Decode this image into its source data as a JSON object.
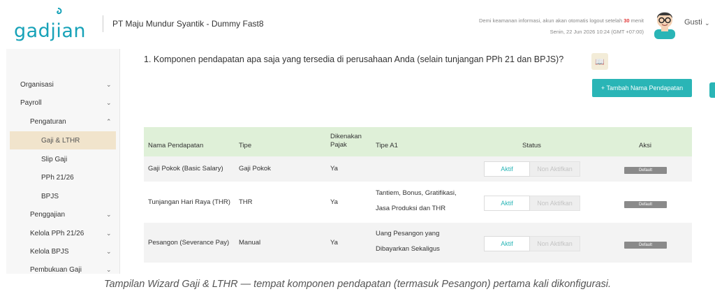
{
  "header": {
    "logo": "gadjian",
    "company": "PT Maju Mundur Syantik - Dummy Fast8",
    "notice_prefix": "Demi keamanan informasi, akun akan otomatis logout setelah",
    "notice_minutes": "30",
    "notice_suffix": "menit",
    "datetime": "Senin, 22 Jun 2026 10:24 (GMT +07:00)",
    "user": "Gusti",
    "accent_color": "#17a2b8"
  },
  "sidebar": {
    "items": [
      {
        "label": "Organisasi",
        "chevron": "⌄"
      },
      {
        "label": "Payroll",
        "chevron": "⌄"
      },
      {
        "label": "Pengaturan",
        "chevron": "⌃"
      },
      {
        "label": "Gaji & LTHR",
        "chevron": ""
      },
      {
        "label": "Slip Gaji",
        "chevron": ""
      },
      {
        "label": "PPh 21/26",
        "chevron": ""
      },
      {
        "label": "BPJS",
        "chevron": ""
      },
      {
        "label": "Penggajian",
        "chevron": "⌄"
      },
      {
        "label": "Kelola PPh 21/26",
        "chevron": "⌄"
      },
      {
        "label": "Kelola BPJS",
        "chevron": "⌄"
      },
      {
        "label": "Pembukuan Gaji",
        "chevron": "⌄"
      }
    ]
  },
  "main": {
    "question": "1. Komponen pendapatan apa saja yang tersedia di perusahaan Anda (selain tunjangan PPh 21 dan BPJS)?",
    "help_icon": "book-icon",
    "add_button": "+ Tambah Nama Pendapatan",
    "table": {
      "headers": {
        "nama": "Nama Pendapatan",
        "tipe": "Tipe",
        "pajak_1": "Dikenakan",
        "pajak_2": "Pajak",
        "tipe_a1": "Tipe A1",
        "status": "Status",
        "aksi": "Aksi"
      },
      "rows": [
        {
          "nama": "Gaji Pokok (Basic Salary)",
          "tipe": "Gaji Pokok",
          "pajak": "Ya",
          "tipe_a1_1": "",
          "tipe_a1_2": "",
          "status_on": "Aktif",
          "status_off": "Non Aktifkan",
          "aksi": "Default"
        },
        {
          "nama": "Tunjangan Hari Raya (THR)",
          "tipe": "THR",
          "pajak": "Ya",
          "tipe_a1_1": "Tantiem, Bonus, Gratifikasi,",
          "tipe_a1_2": "Jasa Produksi dan THR",
          "status_on": "Aktif",
          "status_off": "Non Aktifkan",
          "aksi": "Default"
        },
        {
          "nama": "Pesangon (Severance Pay)",
          "tipe": "Manual",
          "pajak": "Ya",
          "tipe_a1_1": "Uang Pesangon yang",
          "tipe_a1_2": "Dibayarkan Sekaligus",
          "status_on": "Aktif",
          "status_off": "Non Aktifkan",
          "aksi": "Default"
        }
      ]
    }
  },
  "caption": "Tampilan Wizard Gaji & LTHR — tempat komponen pendapatan (termasuk Pesangon) pertama kali dikonfigurasi."
}
